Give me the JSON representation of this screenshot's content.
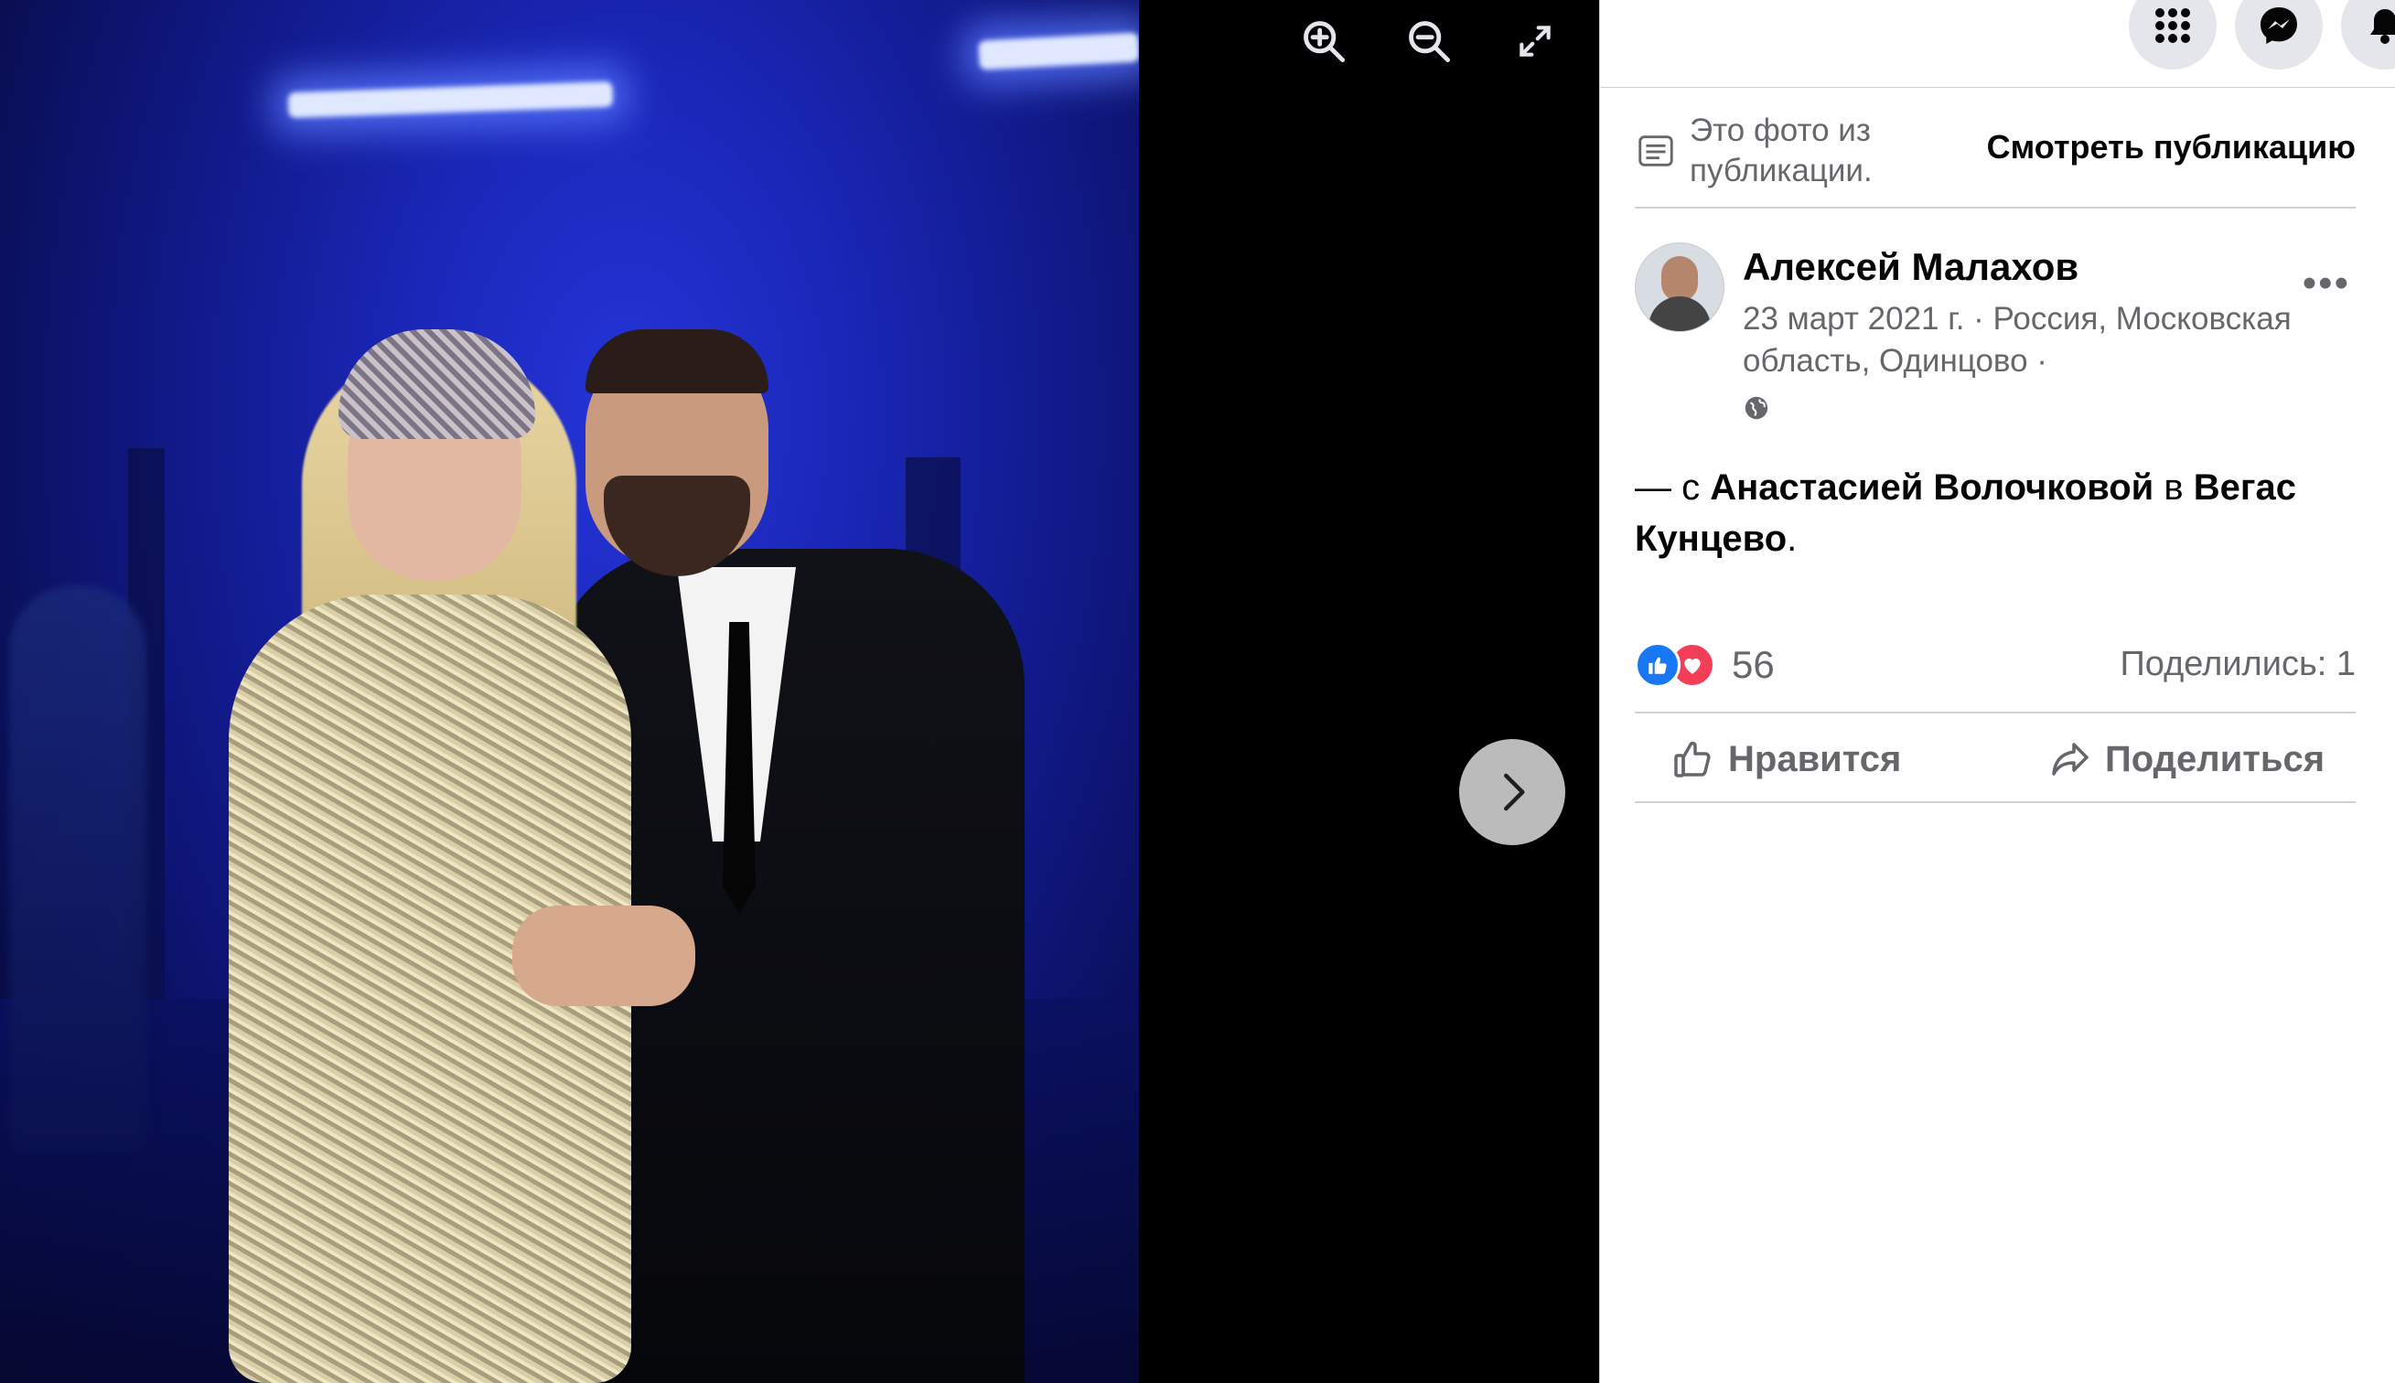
{
  "viewer": {
    "icons": {
      "zoom_in": "zoom-in-icon",
      "zoom_out": "zoom-out-icon",
      "fullscreen": "fullscreen-icon",
      "next": "chevron-right-icon"
    }
  },
  "header": {
    "icons": [
      "menu-grid-icon",
      "messenger-icon",
      "notifications-icon"
    ]
  },
  "notice": {
    "text": "Это фото из публикации.",
    "link": "Смотреть публикацию"
  },
  "post": {
    "author": "Алексей Малахов",
    "date": "23 март 2021 г.",
    "location": " · Россия, Московская область, Одинцово · ",
    "caption_prefix": "— с ",
    "tagged_person": "Анастасией Волочковой",
    "caption_mid": " в ",
    "tagged_place": "Вегас Кунцево",
    "caption_suffix": "."
  },
  "stats": {
    "reactions_count": "56",
    "shares": "Поделились: 1"
  },
  "actions": {
    "like": "Нравится",
    "share": "Поделиться"
  },
  "colors": {
    "accent": "#1877f2",
    "love": "#f33e58",
    "secondary_text": "#65676b",
    "divider": "#ced0d4"
  }
}
